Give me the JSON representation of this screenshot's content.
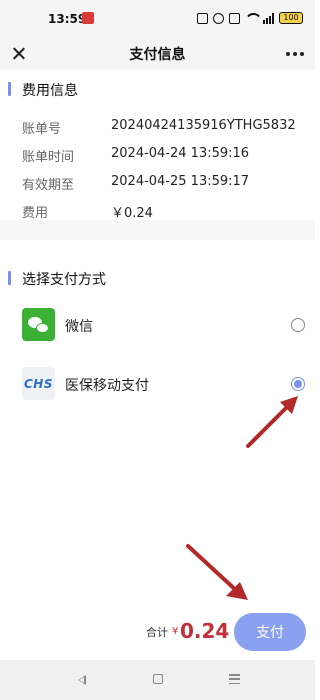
{
  "status_bar": {
    "time": "13:59",
    "battery": "100"
  },
  "nav": {
    "title": "支付信息"
  },
  "fee_section": {
    "title": "费用信息",
    "rows": [
      {
        "label": "账单号",
        "value": "20240424135916YTHG5832"
      },
      {
        "label": "账单时间",
        "value": "2024-04-24 13:59:16"
      },
      {
        "label": "有效期至",
        "value": "2024-04-25 13:59:17"
      },
      {
        "label": "费用",
        "value": "￥0.24"
      }
    ]
  },
  "payment_section": {
    "title": "选择支付方式",
    "options": [
      {
        "label": "微信",
        "selected": false
      },
      {
        "label": "医保移动支付",
        "selected": true,
        "icon_text": "CHS"
      }
    ]
  },
  "footer": {
    "total_label": "合计",
    "currency": "¥",
    "amount": "0.24",
    "pay_button": "支付"
  },
  "colors": {
    "accent": "#7a8ff0",
    "price": "#c0303a",
    "arrow": "#b02a2a"
  }
}
